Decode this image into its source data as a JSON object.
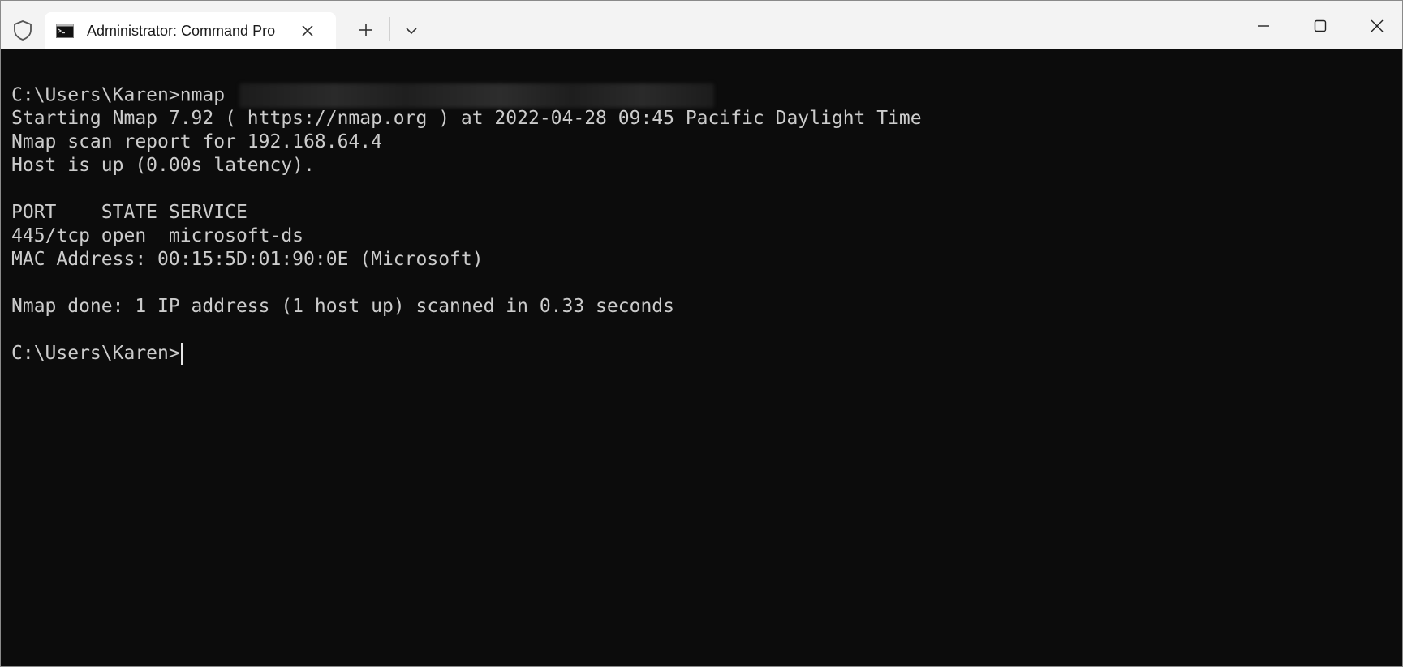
{
  "window": {
    "tab_title": "Administrator: Command Pro",
    "tab_icon": "command-prompt-icon",
    "shield_icon": "shield-icon"
  },
  "controls": {
    "new_tab_icon": "plus-icon",
    "dropdown_icon": "chevron-down-icon",
    "minimize_icon": "minimize-icon",
    "maximize_icon": "maximize-icon",
    "close_icon": "close-icon"
  },
  "terminal": {
    "command_line": {
      "prompt": "C:\\Users\\Karen>",
      "command": "nmap "
    },
    "lines": [
      "Starting Nmap 7.92 ( https://nmap.org ) at 2022-04-28 09:45 Pacific Daylight Time",
      "Nmap scan report for 192.168.64.4",
      "Host is up (0.00s latency).",
      "PORT    STATE SERVICE",
      "445/tcp open  microsoft-ds",
      "MAC Address: 00:15:5D:01:90:0E (Microsoft)",
      "Nmap done: 1 IP address (1 host up) scanned in 0.33 seconds"
    ],
    "final_prompt": "C:\\Users\\Karen>"
  },
  "colors": {
    "terminal_bg": "#0c0c0c",
    "terminal_fg": "#cccccc",
    "titlebar_bg": "#f3f3f3",
    "tab_bg": "#ffffff"
  }
}
